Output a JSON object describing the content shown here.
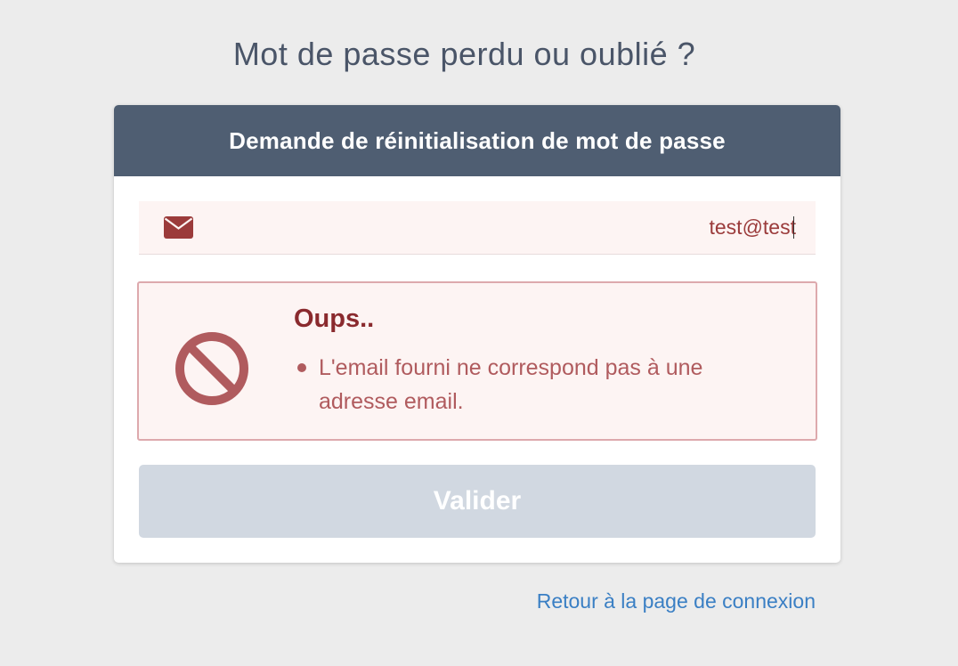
{
  "page": {
    "title": "Mot de passe perdu ou oublié ?"
  },
  "card": {
    "header": "Demande de réinitialisation de mot de passe",
    "email_field": {
      "icon": "envelope-icon",
      "value": "test@test"
    },
    "alert": {
      "icon": "ban-icon",
      "title": "Oups..",
      "messages": [
        "L'email fourni ne correspond pas à une adresse email."
      ]
    },
    "submit_label": "Valider"
  },
  "footer": {
    "back_link_label": "Retour à la page de connexion"
  },
  "colors": {
    "background": "#ececec",
    "header": "#4f5e72",
    "error_text": "#8a2a2e",
    "error_background": "#fdf4f3",
    "error_border": "#dda9ad",
    "button_disabled": "#d1d8e1",
    "link": "#3a7fc4"
  }
}
